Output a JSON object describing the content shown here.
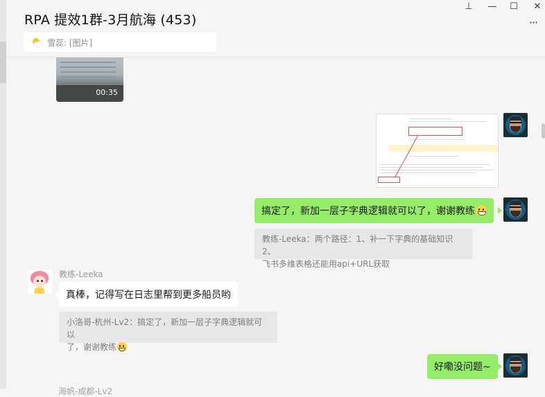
{
  "window": {
    "title": "RPA 提效1群-3月航海 (453)",
    "controls": {
      "pin": "⊥",
      "minimize": "—",
      "maximize": "☐",
      "close": "✕",
      "more": "···"
    }
  },
  "pinned": {
    "text": "雪蕊: [图片]"
  },
  "messages": {
    "video": {
      "duration": "00:35"
    },
    "m2": {
      "text": "搞定了，新加一层子字典逻辑就可以了，谢谢教练"
    },
    "m2_quote": {
      "line1": "教练-Leeka：两个路径：1、补一下字典的基础知识2、",
      "line2": "飞书多维表格还能用api+URL获取"
    },
    "m3": {
      "sender": "教练-Leeka",
      "text": "真棒，记得写在日志里帮到更多船员哟",
      "quote_line1": "小洛哥-杭州-Lv2：搞定了，新加一层子字典逻辑就可以",
      "quote_line2": "了，谢谢教练"
    },
    "m4": {
      "text": "好嘞没问题~"
    },
    "next_sender": "海帆-成都-Lv2"
  },
  "colors": {
    "self_bubble": "#95ec69",
    "other_bubble": "#ffffff",
    "quote_bg": "#e7e7e7",
    "background": "#f5f5f5"
  }
}
